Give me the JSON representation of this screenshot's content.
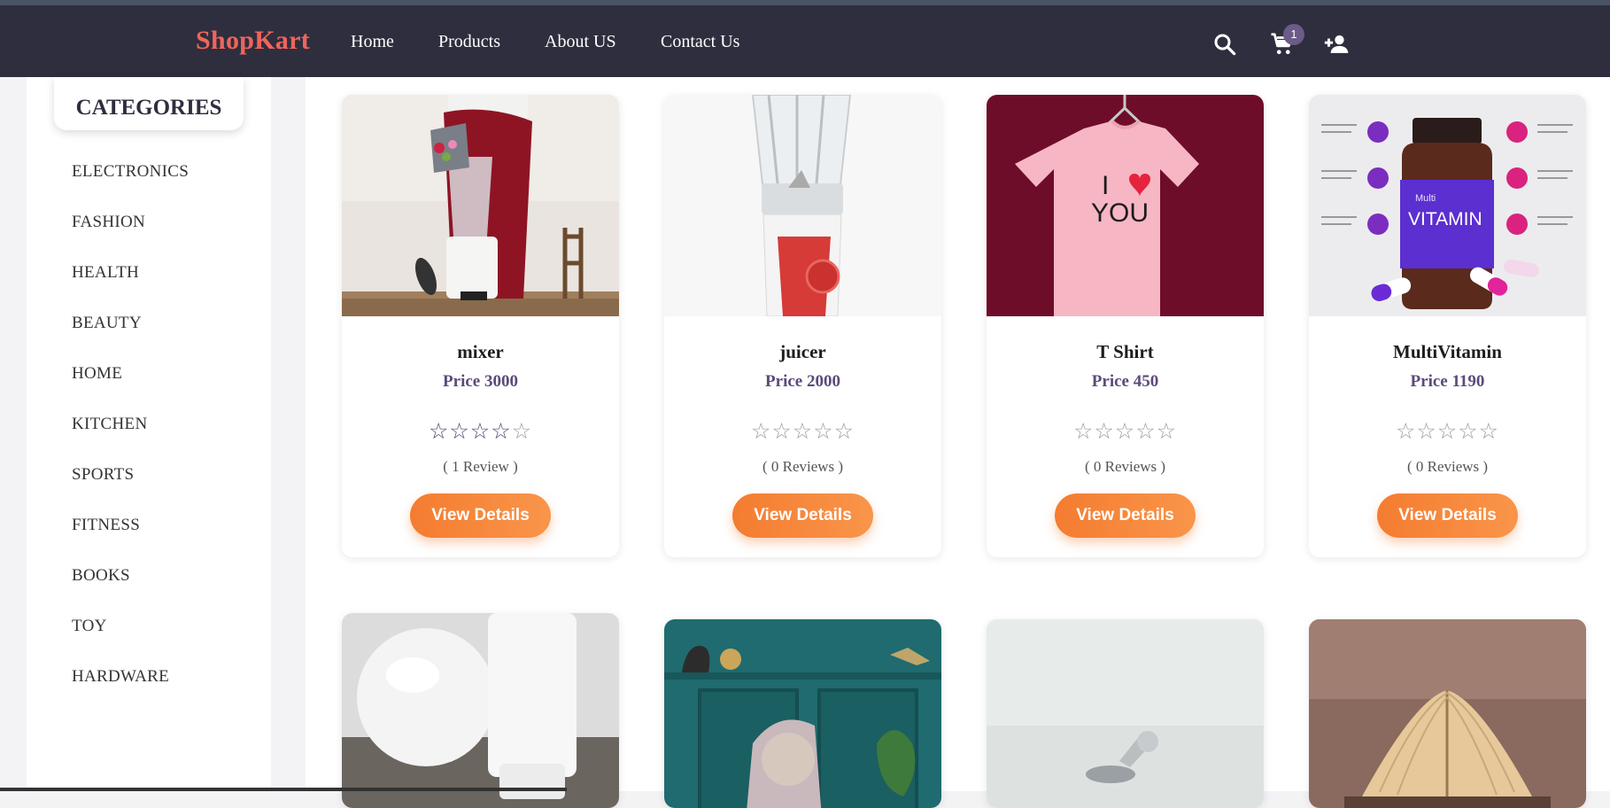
{
  "brand": "ShopKart",
  "nav": {
    "links": [
      "Home",
      "Products",
      "About US",
      "Contact Us"
    ],
    "cart_count": "1",
    "icons": [
      "search-icon",
      "cart-icon",
      "add-user-icon"
    ]
  },
  "sidebar": {
    "title": "CATEGORIES",
    "items": [
      "ELECTRONICS",
      "FASHION",
      "HEALTH",
      "BEAUTY",
      "HOME",
      "KITCHEN",
      "SPORTS",
      "FITNESS",
      "BOOKS",
      "TOY",
      "HARDWARE"
    ]
  },
  "products": [
    {
      "name": "mixer",
      "price": "Price 3000",
      "rating": 4,
      "reviews": "( 1 Review )",
      "button": "View Details"
    },
    {
      "name": "juicer",
      "price": "Price 2000",
      "rating": 0,
      "reviews": "( 0 Reviews )",
      "button": "View Details"
    },
    {
      "name": "T Shirt",
      "price": "Price 450",
      "rating": 0,
      "reviews": "( 0 Reviews )",
      "button": "View Details"
    },
    {
      "name": "MultiVitamin",
      "price": "Price 1190",
      "rating": 0,
      "reviews": "( 0 Reviews )",
      "button": "View Details"
    }
  ],
  "tshirt_print": [
    "I",
    "YOU"
  ],
  "vitamin_label": [
    "Multi",
    "VITAMIN"
  ],
  "colors": {
    "navbar": "#2e2e3e",
    "brand": "#f0645a",
    "button": "#f47c30",
    "price": "#5b4b7a"
  }
}
